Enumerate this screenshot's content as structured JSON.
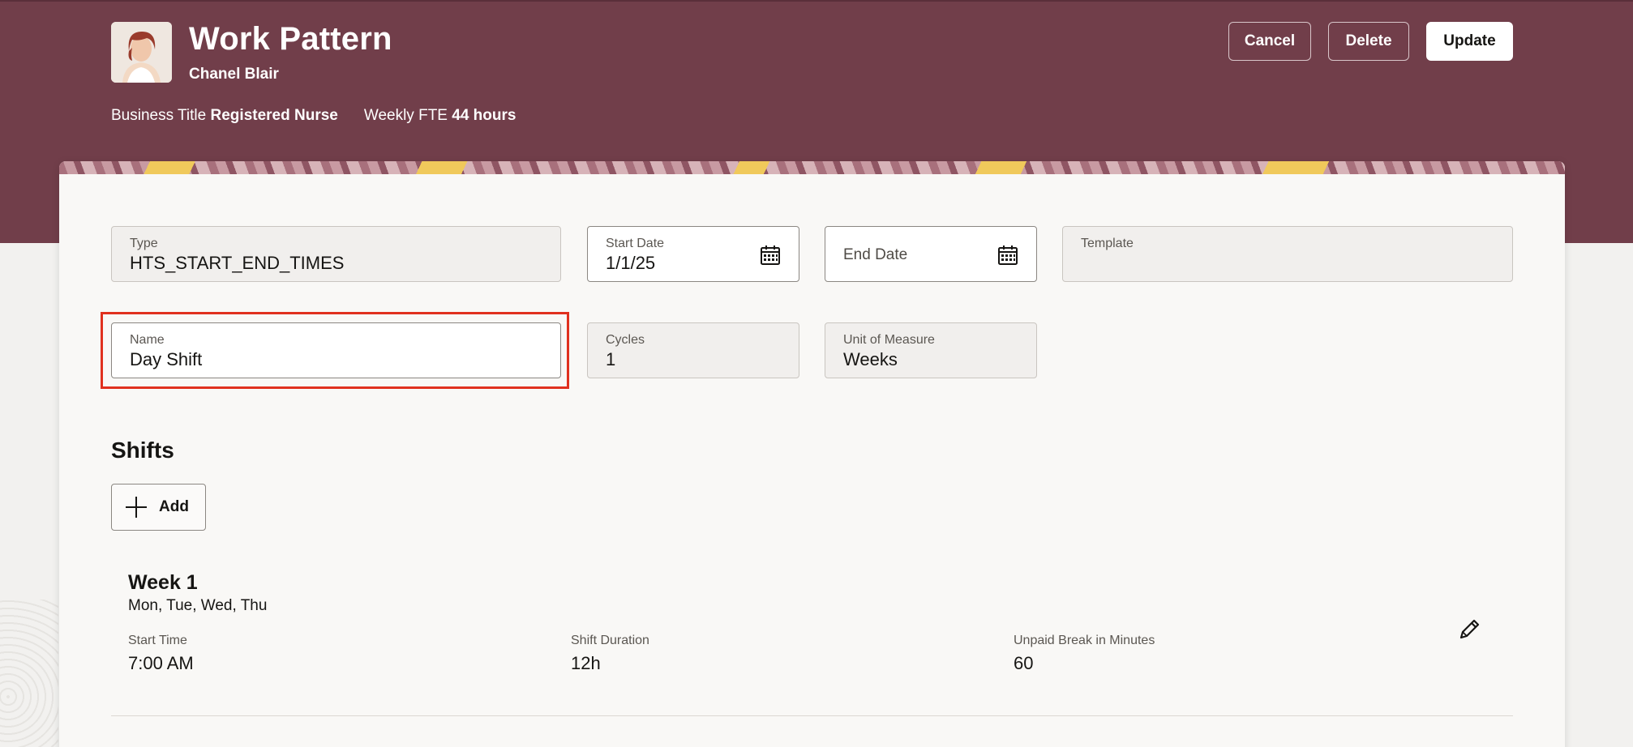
{
  "header": {
    "title": "Work Pattern",
    "person_name": "Chanel Blair",
    "business_title_label": "Business Title",
    "business_title_value": "Registered Nurse",
    "weekly_fte_label": "Weekly FTE",
    "weekly_fte_value": "44 hours",
    "buttons": {
      "cancel": "Cancel",
      "delete": "Delete",
      "update": "Update"
    }
  },
  "form": {
    "type": {
      "label": "Type",
      "value": "HTS_START_END_TIMES"
    },
    "start_date": {
      "label": "Start Date",
      "value": "1/1/25"
    },
    "end_date": {
      "label": "End Date",
      "value": ""
    },
    "template": {
      "label": "Template",
      "value": ""
    },
    "name": {
      "label": "Name",
      "value": "Day Shift"
    },
    "cycles": {
      "label": "Cycles",
      "value": "1"
    },
    "unit_of_measure": {
      "label": "Unit of Measure",
      "value": "Weeks"
    }
  },
  "shifts": {
    "title": "Shifts",
    "add_label": "Add",
    "weeks": [
      {
        "title": "Week 1",
        "days": "Mon, Tue, Wed, Thu",
        "start_time_label": "Start Time",
        "start_time": "7:00 AM",
        "duration_label": "Shift Duration",
        "duration": "12h",
        "break_label": "Unpaid Break in Minutes",
        "break": "60"
      }
    ]
  },
  "colors": {
    "header_bg": "#713e4a",
    "highlight": "#e0301e",
    "card_bg": "#f9f8f6"
  }
}
